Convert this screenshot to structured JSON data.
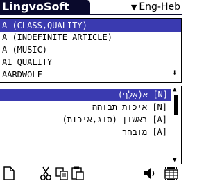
{
  "app": {
    "title": "LingvoSoft",
    "language_pair": "Eng-Heb"
  },
  "search": {
    "value": "A (CLASS,QUALITY)"
  },
  "word_list": [
    "A (INDEFINITE ARTICLE)",
    "A (MUSIC)",
    "A1 QUALITY",
    "AARDWOLF"
  ],
  "translations": [
    "א(אָלֶף) [N]",
    "איכות תבוהה [N]",
    "ראשון (סוג,איכות) [A]",
    "מובחר [A]"
  ],
  "icons": {
    "new": "new-document-icon",
    "cut": "scissors-icon",
    "copy": "copy-icon",
    "paste": "paste-icon",
    "speak": "speaker-icon",
    "keyboard": "keyboard-icon"
  },
  "colors": {
    "selection": "#3a3ab0",
    "title_bar": "#0a0a2c"
  }
}
